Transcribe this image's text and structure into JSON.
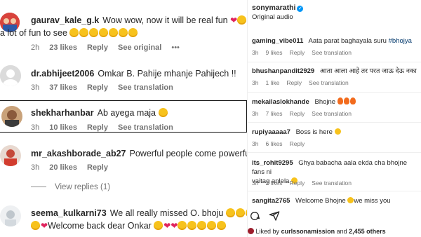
{
  "comments": [
    {
      "username": "gaurav_kale_g.k",
      "text": "Wow wow, now it will be real fun",
      "text_line2": "a lot of fun to see",
      "time": "2h",
      "likes": "23 likes",
      "reply": "Reply",
      "translation": "See original",
      "more": "•••"
    },
    {
      "username": "dr.abhijeet2006",
      "text": "Omkar B. Pahije mhanje Pahijech !!",
      "time": "3h",
      "likes": "37 likes",
      "reply": "Reply",
      "translation": "See translation"
    },
    {
      "username": "shekharhanbar",
      "text": "Ab ayega maja",
      "time": "3h",
      "likes": "10 likes",
      "reply": "Reply",
      "translation": "See translation"
    },
    {
      "username": "mr_akashborade_ab27",
      "text": "Powerful people come powerful pl",
      "time": "3h",
      "likes": "20 likes",
      "reply": "Reply"
    },
    {
      "username": "seema_kulkarni73",
      "text": "We all really missed O. bhoju",
      "text_line2": "Welcome back dear Onkar"
    }
  ],
  "view_replies": "View replies (1)",
  "right_panel": {
    "account": "sonymarathi",
    "audio": "Original audio",
    "comments": [
      {
        "username": "gaming_vibe011",
        "text": "Aata parat baghayala suru",
        "hashtag": "#bhojya",
        "time": "3h",
        "likes": "9 likes",
        "reply": "Reply",
        "translation": "See translation"
      },
      {
        "username": "bhushanpandit2929",
        "text": "आता आला आहे तर परत जाऊ देऊ नका",
        "time": "3h",
        "likes": "1 like",
        "reply": "Reply",
        "translation": "See translation"
      },
      {
        "username": "mekailaslokhande",
        "text": "Bhojne",
        "time": "3h",
        "likes": "7 likes",
        "reply": "Reply",
        "translation": "See translation"
      },
      {
        "username": "rupiyaaaaa7",
        "text": "Boss is here",
        "time": "3h",
        "likes": "6 likes",
        "reply": "Reply"
      },
      {
        "username": "its_rohit9295",
        "text": "Ghya babacha aala ekda cha bhojne fans ni",
        "text_line2": "vaitag anlela",
        "time": "3h",
        "likes": "2 likes",
        "reply": "Reply",
        "translation": "See translation"
      },
      {
        "username": "sangita2765",
        "text": "Welcome Bhojne",
        "text_tail": "we miss you"
      }
    ],
    "liked_prefix": "Liked by",
    "liked_user": "curlssonamission",
    "liked_and": "and",
    "liked_count": "2,455 others"
  }
}
